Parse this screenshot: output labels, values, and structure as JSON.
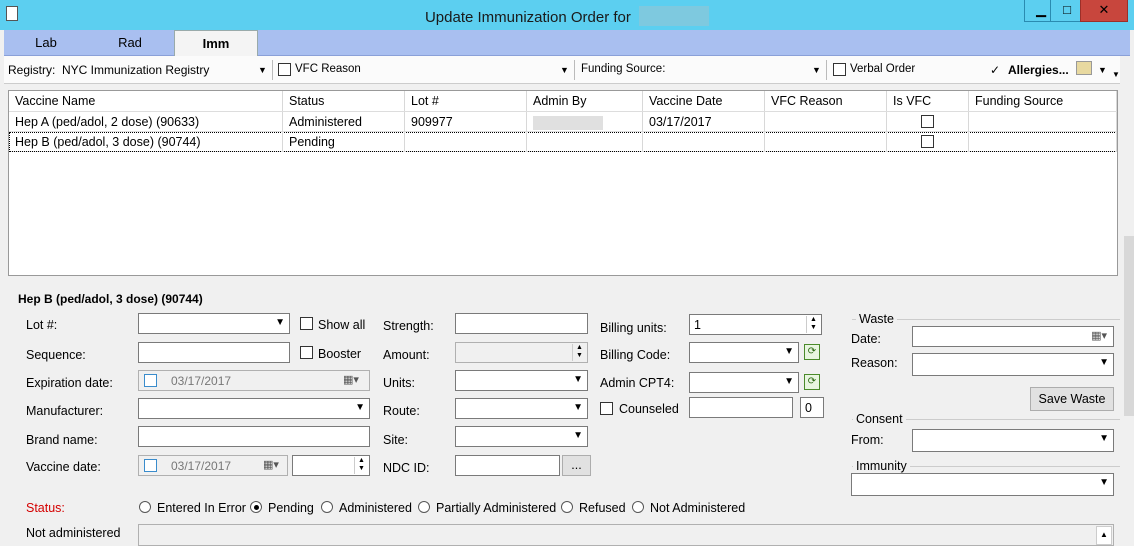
{
  "window": {
    "title": "Update Immunization Order for",
    "min": "▁",
    "max": "□",
    "close": "✕"
  },
  "tabs": [
    "Lab",
    "Rad",
    "Imm"
  ],
  "toolbar": {
    "registry_label": "Registry:",
    "registry_value": "NYC Immunization Registry",
    "vfc_reason_label": "VFC Reason",
    "funding_label": "Funding Source:",
    "verbal_order_label": "Verbal Order",
    "allergies_check": "✓",
    "allergies_label": "Allergies..."
  },
  "grid": {
    "columns": [
      "Vaccine Name",
      "Status",
      "Lot #",
      "Admin By",
      "Vaccine Date",
      "VFC Reason",
      "Is VFC",
      "Funding Source"
    ],
    "rows": [
      [
        "Hep A (ped/adol, 2 dose) (90633)",
        "Administered",
        "909977",
        "",
        "03/17/2017",
        "",
        "",
        ""
      ],
      [
        "Hep B (ped/adol, 3 dose) (90744)",
        "Pending",
        "",
        "",
        "",
        "",
        "",
        ""
      ]
    ]
  },
  "detail": {
    "heading": "Hep B (ped/adol, 3 dose) (90744)",
    "lot_label": "Lot #:",
    "show_all": "Show all",
    "sequence_label": "Sequence:",
    "booster": "Booster",
    "expiration_label": "Expiration date:",
    "expiration_value": "03/17/2017",
    "manufacturer_label": "Manufacturer:",
    "brand_label": "Brand name:",
    "vaccine_date_label": "Vaccine date:",
    "vaccine_date_value": "03/17/2017",
    "strength_label": "Strength:",
    "amount_label": "Amount:",
    "units_label": "Units:",
    "route_label": "Route:",
    "site_label": "Site:",
    "ndc_label": "NDC ID:",
    "ndc_button": "...",
    "billing_units_label": "Billing units:",
    "billing_units_value": "1",
    "billing_code_label": "Billing Code:",
    "admin_cpt_label": "Admin CPT4:",
    "counseled": "Counseled",
    "counseled_count": "0",
    "waste_group": "Waste",
    "waste_date_label": "Date:",
    "waste_reason_label": "Reason:",
    "save_waste": "Save Waste",
    "consent_group": "Consent",
    "consent_from_label": "From:",
    "immunity_group": "Immunity",
    "status_label": "Status:",
    "status_options": [
      "Entered In Error",
      "Pending",
      "Administered",
      "Partially Administered",
      "Refused",
      "Not Administered"
    ],
    "status_selected": "Pending",
    "not_administered_label": "Not administered"
  },
  "colors": {
    "titlebar": "#5ccff0",
    "tabstrip": "#a9bff0",
    "status_label": "#d40000"
  }
}
